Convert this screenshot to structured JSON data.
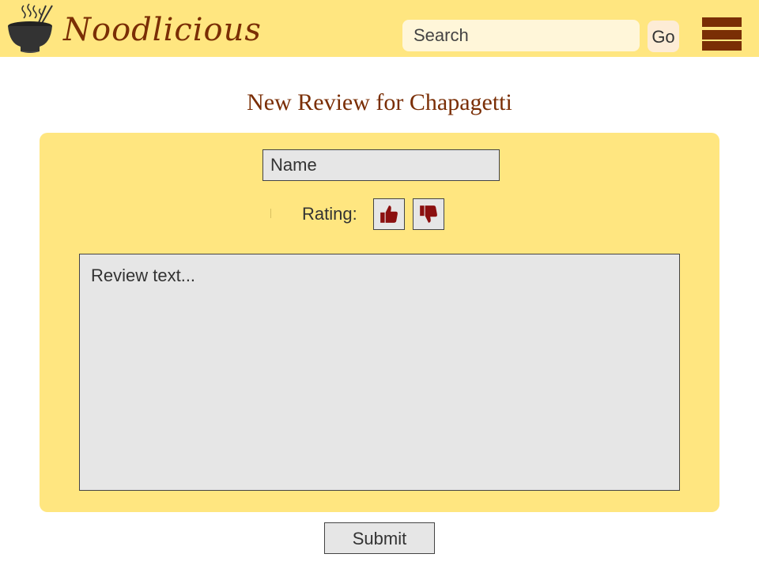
{
  "header": {
    "brand": "Noodlicious",
    "logo_icon": "noodle-bowl-icon",
    "search": {
      "placeholder": "Search",
      "value": ""
    },
    "go_label": "Go",
    "menu_icon": "hamburger-menu-icon"
  },
  "page": {
    "title": "New Review for Chapagetti"
  },
  "form": {
    "name": {
      "placeholder": "Name",
      "value": ""
    },
    "rating": {
      "label": "Rating:",
      "up_icon": "thumbs-up-icon",
      "down_icon": "thumbs-down-icon"
    },
    "review": {
      "placeholder": "Review text...",
      "value": ""
    },
    "submit_label": "Submit"
  },
  "colors": {
    "header_bg": "#ffe680",
    "brand": "#7a2e05",
    "panel_bg": "#ffe680",
    "thumb_icon": "#8b1010",
    "field_bg": "#e6e6e6"
  }
}
